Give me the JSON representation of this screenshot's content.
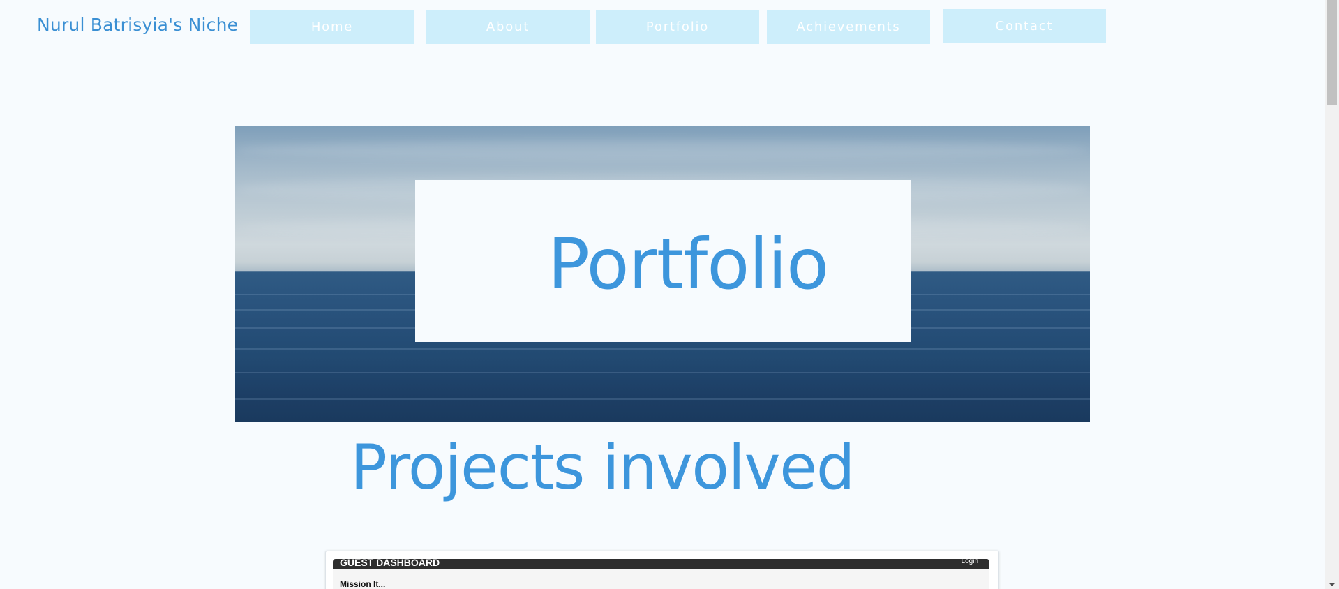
{
  "header": {
    "site_title": "Nurul Batrisyia's Niche"
  },
  "nav": {
    "items": [
      {
        "label": "Home"
      },
      {
        "label": "About"
      },
      {
        "label": "Portfolio"
      },
      {
        "label": "Achievements"
      },
      {
        "label": "Contact"
      }
    ]
  },
  "hero": {
    "title": "Portfolio"
  },
  "projects": {
    "heading": "Projects involved"
  },
  "embed": {
    "dashboard_title": "GUEST DASHBOARD",
    "login_label": "Login",
    "body_text": "Mission It..."
  },
  "colors": {
    "accent": "#3d96dc",
    "nav_bg": "#cdeefb",
    "page_bg": "#f7fbfe"
  }
}
